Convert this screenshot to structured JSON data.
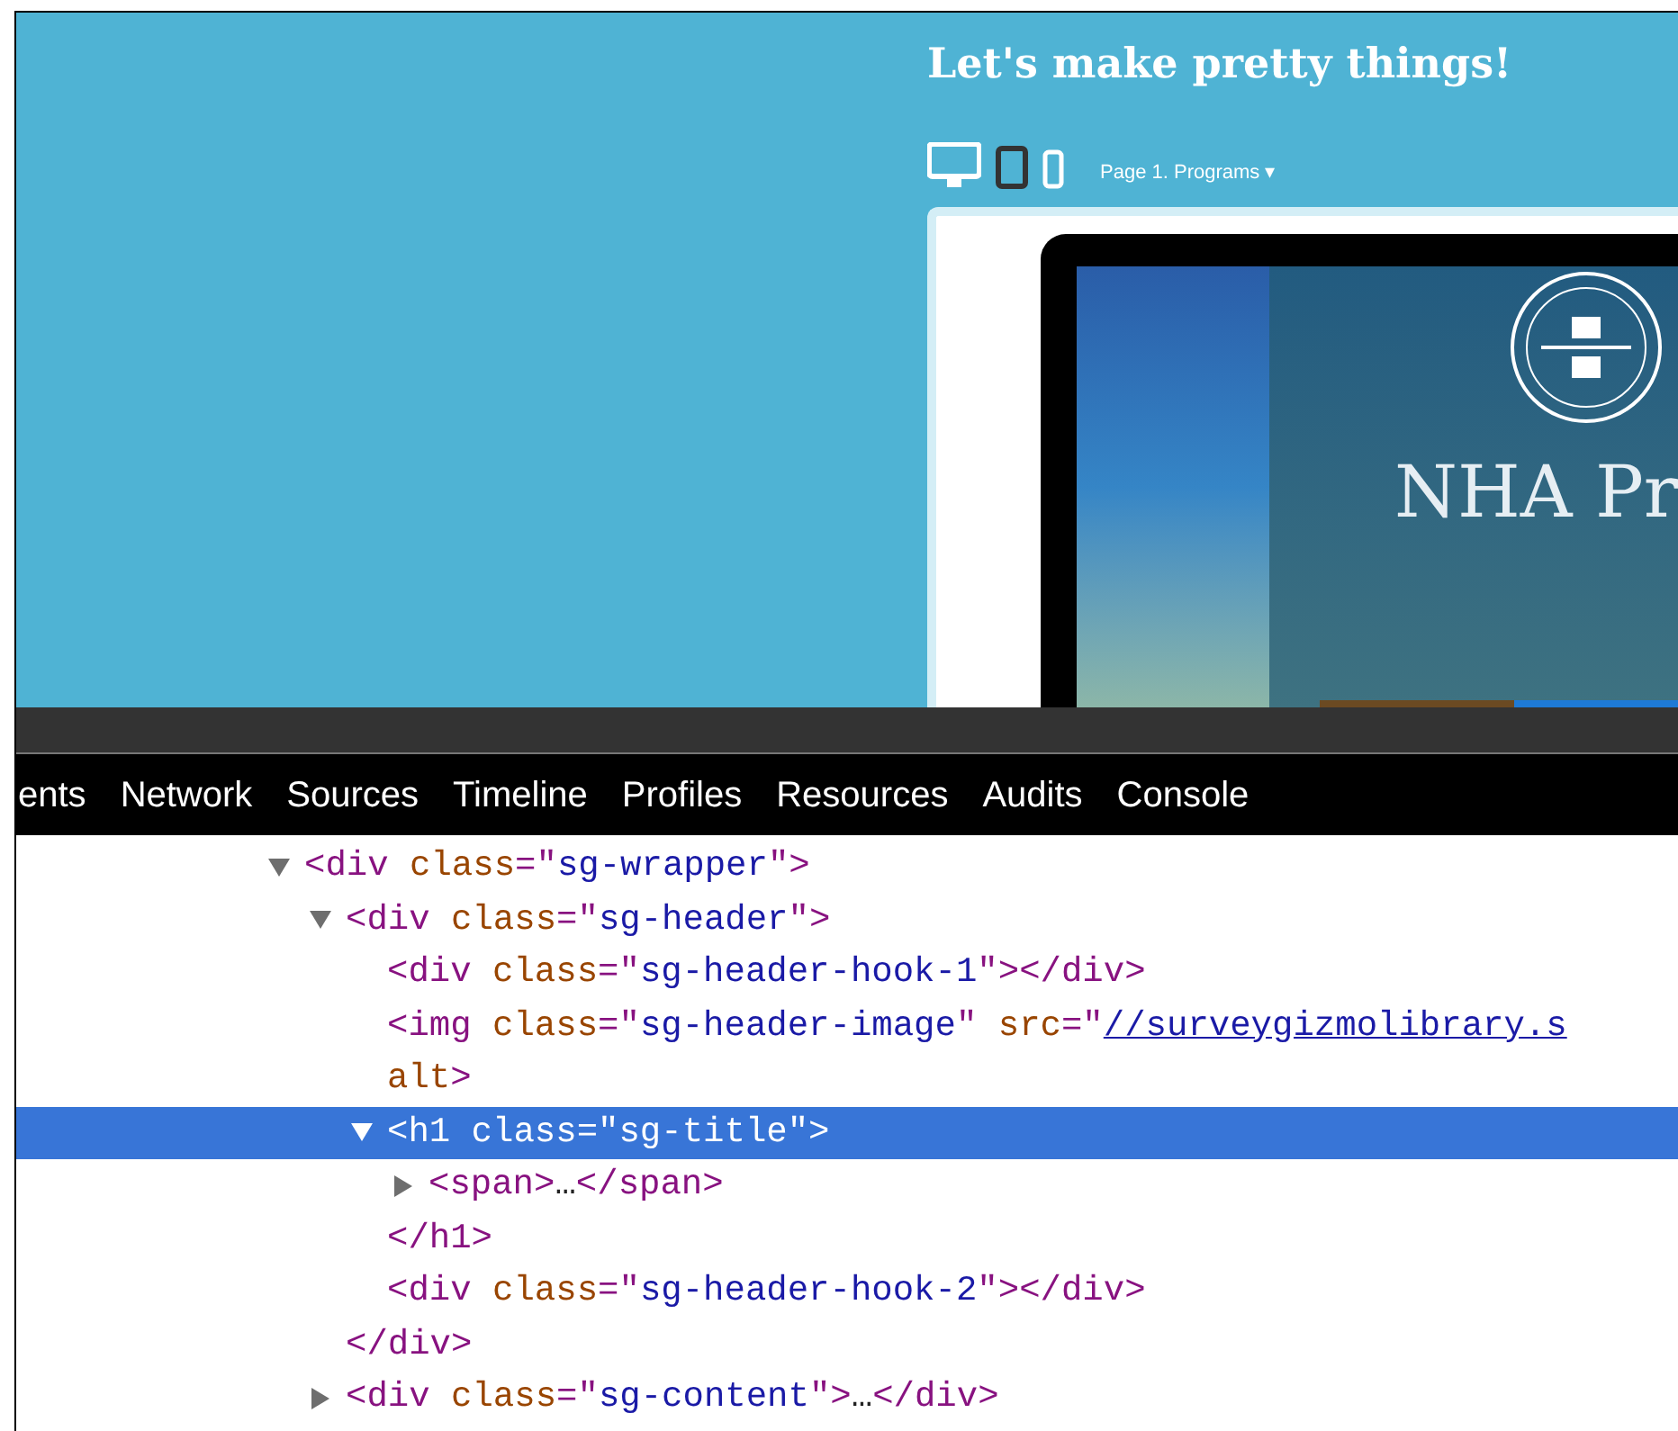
{
  "preview": {
    "title": "Let's make pretty things!",
    "page_menu": "Page 1. Programs",
    "page_menu_caret": "▾",
    "screen_heading": "NHA Pr"
  },
  "devtools_tabs": [
    {
      "label": "ents"
    },
    {
      "label": "Network"
    },
    {
      "label": "Sources"
    },
    {
      "label": "Timeline"
    },
    {
      "label": "Profiles"
    },
    {
      "label": "Resources"
    },
    {
      "label": "Audits"
    },
    {
      "label": "Console"
    }
  ],
  "dom_tree": [
    {
      "expanded": true,
      "selected": false,
      "tokens": [
        {
          "kind": "tag",
          "text": "<div"
        },
        {
          "kind": "attr",
          "text": " class"
        },
        {
          "kind": "tag",
          "text": "=\""
        },
        {
          "kind": "value",
          "text": "sg-wrapper"
        },
        {
          "kind": "tag",
          "text": "\">"
        }
      ],
      "children": [
        {
          "expanded": true,
          "selected": false,
          "tokens": [
            {
              "kind": "tag",
              "text": "<div"
            },
            {
              "kind": "attr",
              "text": " class"
            },
            {
              "kind": "tag",
              "text": "=\""
            },
            {
              "kind": "value",
              "text": "sg-header"
            },
            {
              "kind": "tag",
              "text": "\">"
            }
          ],
          "close": [
            {
              "kind": "tag",
              "text": "</div>"
            }
          ],
          "children": [
            {
              "tokens": [
                {
                  "kind": "tag",
                  "text": "<div"
                },
                {
                  "kind": "attr",
                  "text": " class"
                },
                {
                  "kind": "tag",
                  "text": "=\""
                },
                {
                  "kind": "value",
                  "text": "sg-header-hook-1"
                },
                {
                  "kind": "tag",
                  "text": "\"></div>"
                }
              ]
            },
            {
              "tokens": [
                {
                  "kind": "tag",
                  "text": "<img"
                },
                {
                  "kind": "attr",
                  "text": " class"
                },
                {
                  "kind": "tag",
                  "text": "=\""
                },
                {
                  "kind": "value",
                  "text": "sg-header-image"
                },
                {
                  "kind": "tag",
                  "text": "\""
                },
                {
                  "kind": "attr",
                  "text": " src"
                },
                {
                  "kind": "tag",
                  "text": "=\""
                },
                {
                  "kind": "link",
                  "text": "//surveygizmolibrary.s"
                }
              ],
              "continuation": [
                {
                  "kind": "attr",
                  "text": "alt"
                },
                {
                  "kind": "tag",
                  "text": ">"
                }
              ]
            },
            {
              "expanded": true,
              "selected": true,
              "tokens": [
                {
                  "kind": "tag",
                  "text": "<h1"
                },
                {
                  "kind": "attr",
                  "text": " class"
                },
                {
                  "kind": "tag",
                  "text": "=\""
                },
                {
                  "kind": "value",
                  "text": "sg-title"
                },
                {
                  "kind": "tag",
                  "text": "\">"
                }
              ],
              "close": [
                {
                  "kind": "tag",
                  "text": "</h1>"
                }
              ],
              "children": [
                {
                  "expanded": false,
                  "selected": false,
                  "tokens": [
                    {
                      "kind": "tag",
                      "text": "<span>"
                    },
                    {
                      "kind": "plain",
                      "text": "…"
                    },
                    {
                      "kind": "tag",
                      "text": "</span>"
                    }
                  ]
                }
              ]
            },
            {
              "tokens": [
                {
                  "kind": "tag",
                  "text": "<div"
                },
                {
                  "kind": "attr",
                  "text": " class"
                },
                {
                  "kind": "tag",
                  "text": "=\""
                },
                {
                  "kind": "value",
                  "text": "sg-header-hook-2"
                },
                {
                  "kind": "tag",
                  "text": "\"></div>"
                }
              ]
            }
          ]
        },
        {
          "expanded": false,
          "selected": false,
          "tokens": [
            {
              "kind": "tag",
              "text": "<div"
            },
            {
              "kind": "attr",
              "text": " class"
            },
            {
              "kind": "tag",
              "text": "=\""
            },
            {
              "kind": "value",
              "text": "sg-content"
            },
            {
              "kind": "tag",
              "text": "\">"
            },
            {
              "kind": "plain",
              "text": "…"
            },
            {
              "kind": "tag",
              "text": "</div>"
            }
          ]
        }
      ]
    }
  ]
}
